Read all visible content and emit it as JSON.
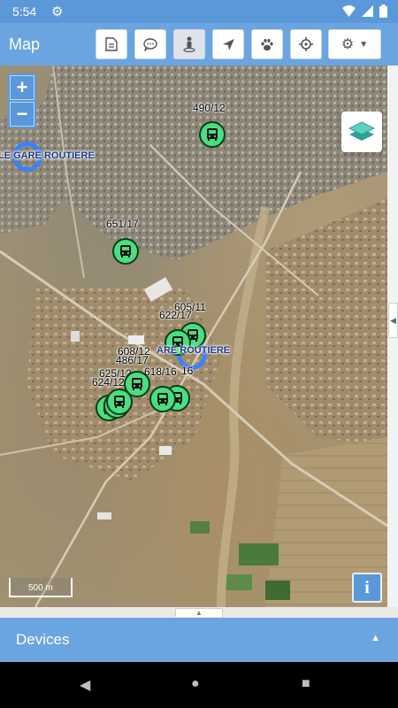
{
  "status_bar": {
    "time": "5:54"
  },
  "toolbar": {
    "title": "Map"
  },
  "map": {
    "zoom_in": "+",
    "zoom_out": "−",
    "scale_label": "500 m",
    "info_label": "i",
    "poi_labels": [
      "LE GARE ROUTIERE",
      "ARE ROUTIERE"
    ]
  },
  "markers": [
    "490/12",
    "651/17",
    "605/11",
    "622/17",
    "608/12",
    "486/17",
    "618/16",
    "625/12",
    "624/12",
    "16"
  ],
  "devices_panel": {
    "label": "Devices"
  },
  "colors": {
    "header": "#6aa5e2",
    "marker": "#4ade80",
    "ring": "#3b82f6"
  }
}
